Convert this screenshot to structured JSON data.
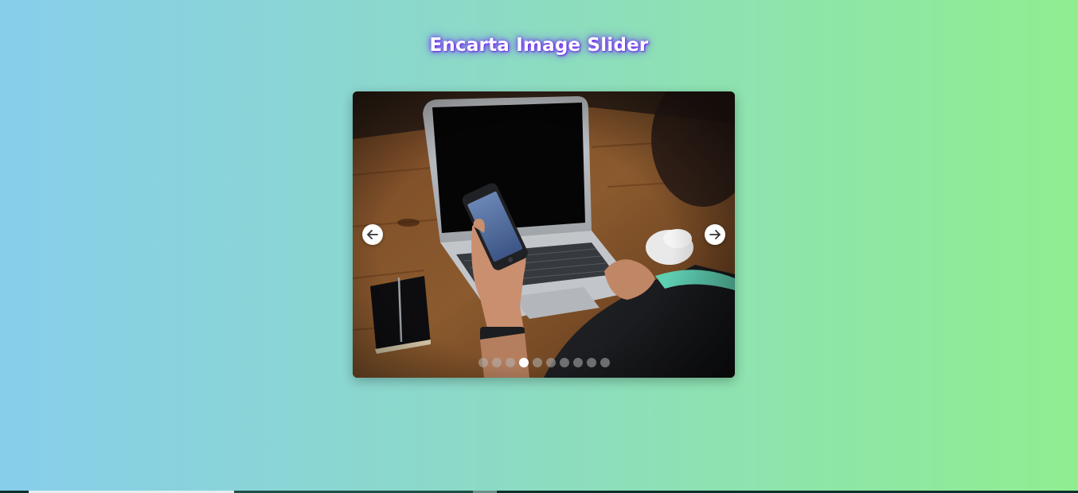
{
  "page": {
    "title": "Encarta Image Slider",
    "background_gradient": [
      "#87CEEB",
      "#90EE90"
    ],
    "title_glow_color": "#7b2ff7"
  },
  "slider": {
    "current_slide": "laptop-phone-desk",
    "prev_icon": "arrow-left-icon",
    "next_icon": "arrow-right-icon",
    "dot_count": 10,
    "active_dot_number": 4
  }
}
